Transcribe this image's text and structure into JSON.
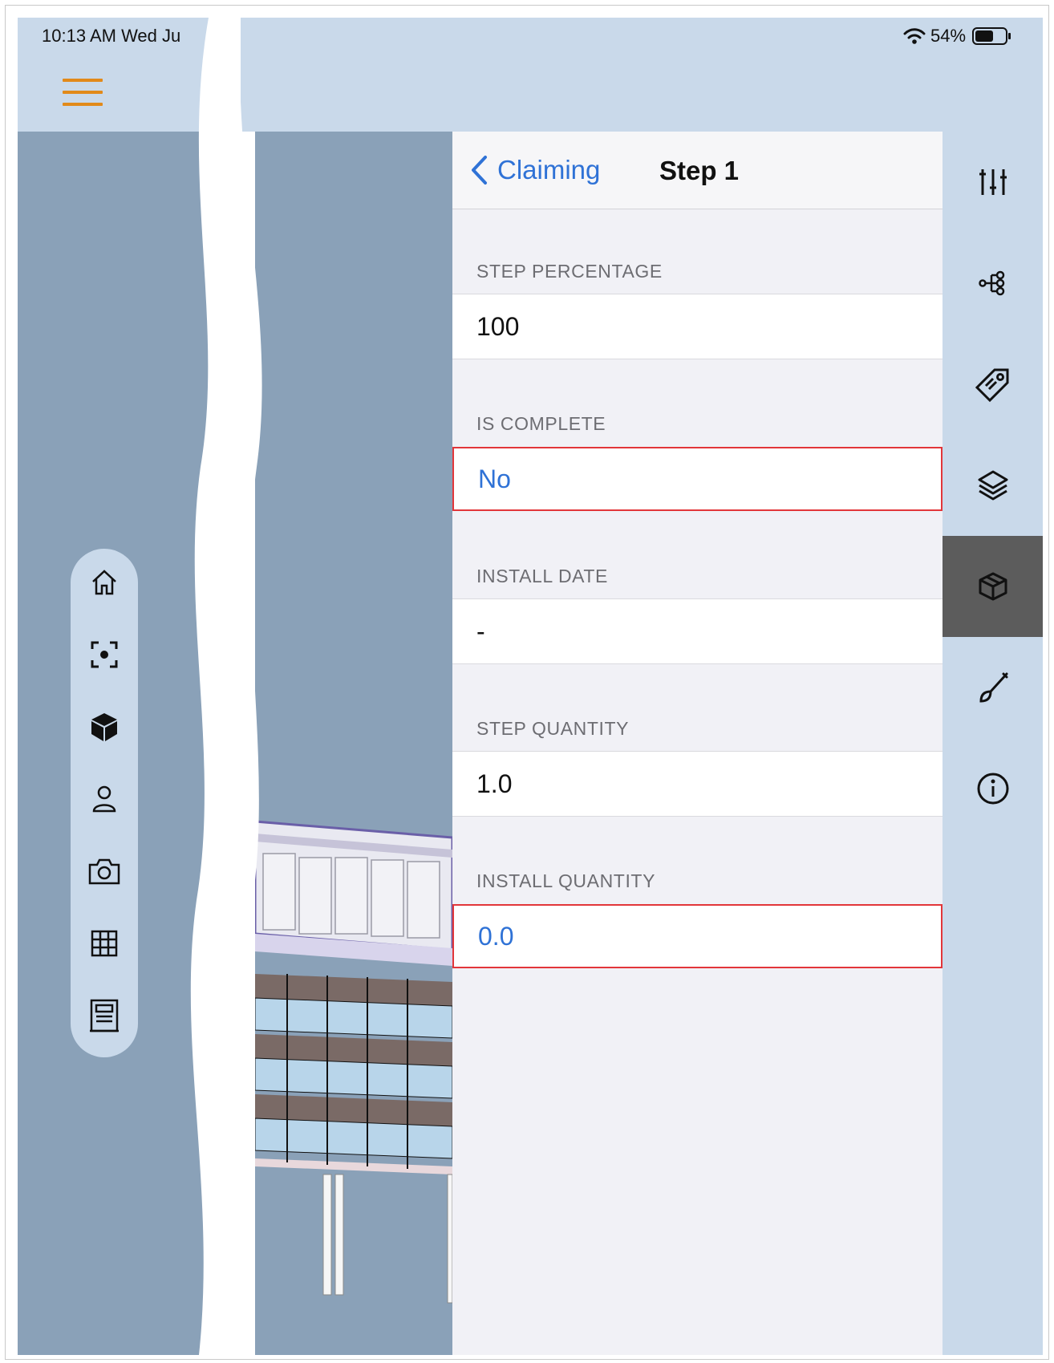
{
  "status_bar": {
    "time_date": "10:13 AM   Wed Ju",
    "battery": "54%"
  },
  "nav": {
    "back_label": "Claiming",
    "title": "Step 1"
  },
  "fields": [
    {
      "label": "STEP PERCENTAGE",
      "value": "100"
    },
    {
      "label": "IS COMPLETE",
      "value": "No"
    },
    {
      "label": "INSTALL DATE",
      "value": "-"
    },
    {
      "label": "STEP QUANTITY",
      "value": "1.0"
    },
    {
      "label": "INSTALL QUANTITY",
      "value": "0.0"
    }
  ],
  "left_toolbar": [
    "home-icon",
    "focus-target-icon",
    "cube-filled-icon",
    "person-icon",
    "camera-icon",
    "grid-icon",
    "sheet-icon"
  ],
  "right_rail": [
    "adjust-sliders-icon",
    "tree-hierarchy-icon",
    "tag-icon",
    "layers-icon",
    "box-icon",
    "brush-icon",
    "info-icon"
  ],
  "colors": {
    "accent_blue": "#2f72d6",
    "hamburger_orange": "#e28a1a",
    "highlight_red": "#e2363a",
    "active_rail": "#5c5c5c"
  }
}
